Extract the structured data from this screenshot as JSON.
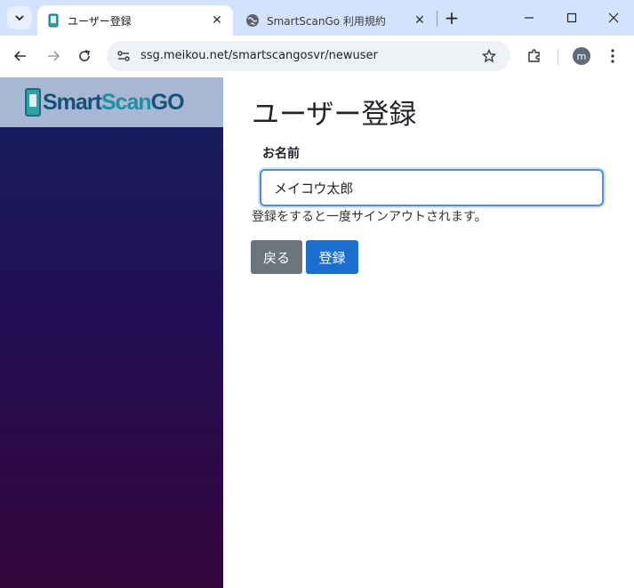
{
  "browser": {
    "tabs": [
      {
        "title": "ユーザー登録",
        "active": true,
        "icon": "phone-favicon-icon"
      },
      {
        "title": "SmartScanGo 利用規約",
        "active": false,
        "icon": "globe-icon"
      }
    ],
    "url": "ssg.meikou.net/smartscangosvr/newuser",
    "profile_initial": "m"
  },
  "sidebar": {
    "logo": {
      "smart": "Smart",
      "scan": "Scan",
      "go": "GO"
    }
  },
  "main": {
    "title": "ユーザー登録",
    "name_label": "お名前",
    "name_value": "メイコウ太郎",
    "note": "登録をすると一度サインアウトされます。",
    "back_label": "戻る",
    "register_label": "登録"
  },
  "colors": {
    "sidebar_top": "#16205e",
    "sidebar_bottom": "#35063c",
    "logo_bar": "#a6b8d3",
    "back_button": "#6c757d",
    "register_button": "#1a6fcf",
    "tab_strip": "#d3e3fd"
  }
}
